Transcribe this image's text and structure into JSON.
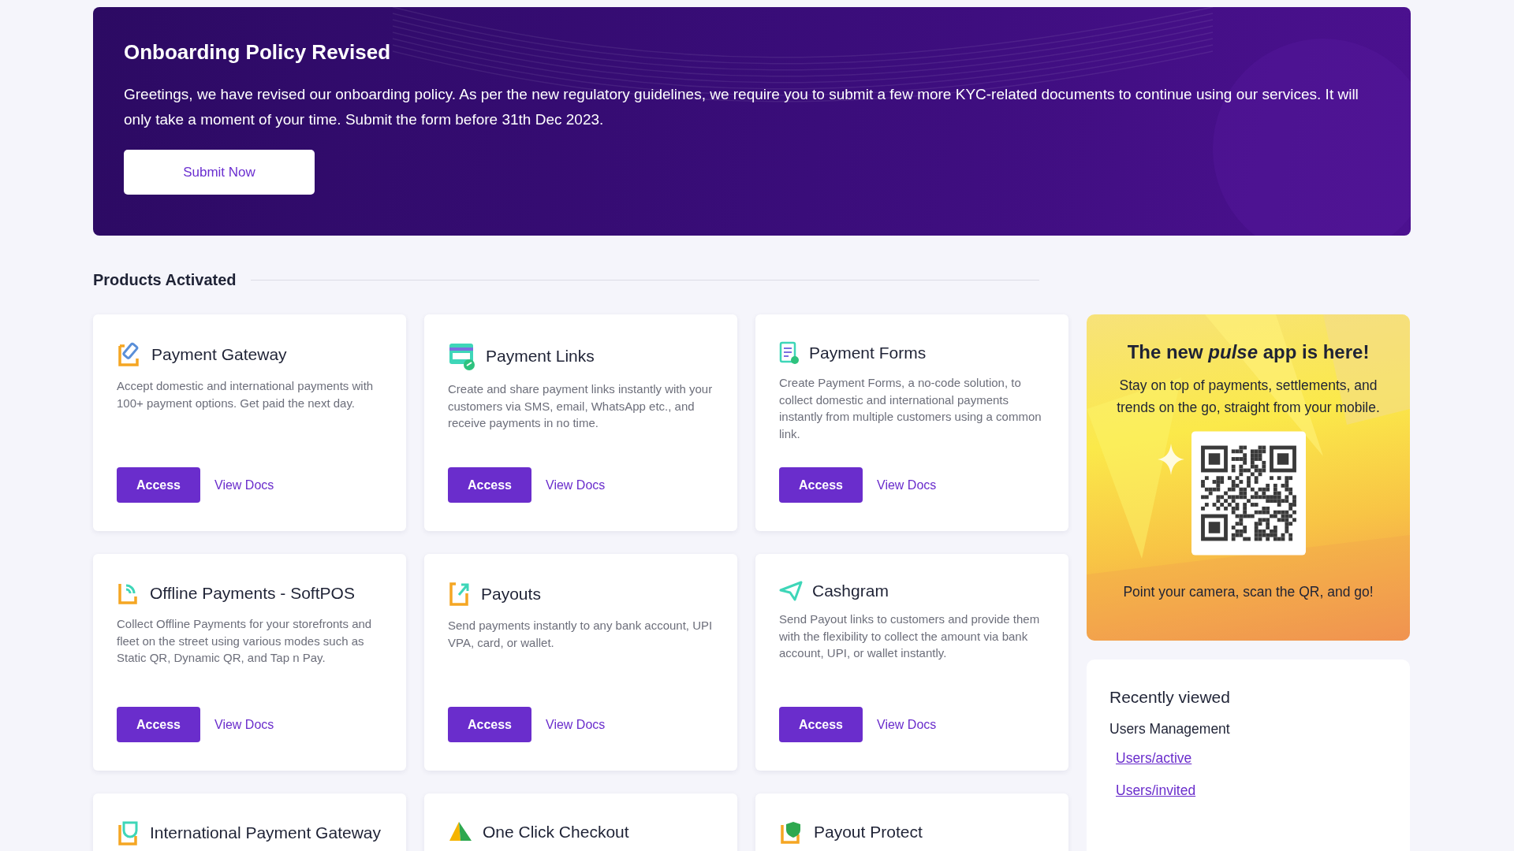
{
  "banner": {
    "title": "Onboarding Policy Revised",
    "message": "Greetings, we have revised our onboarding policy. As per the new regulatory guidelines, we require you to submit a few more KYC-related documents to continue using our services. It will only take a moment of your time. Submit the form before 31th Dec 2023.",
    "button": "Submit Now"
  },
  "section_title": "Products Activated",
  "products": [
    {
      "title": "Payment Gateway",
      "description": "Accept domestic and international payments with 100+ payment options. Get paid the next day.",
      "primary_button": "Access",
      "link": "View Docs"
    },
    {
      "title": "Payment Links",
      "description": "Create and share payment links instantly with your customers via SMS, email, WhatsApp etc., and receive payments in no time.",
      "primary_button": "Access",
      "link": "View Docs"
    },
    {
      "title": "Payment Forms",
      "description": "Create Payment Forms, a no-code solution, to collect domestic and international payments instantly from multiple customers using a common link.",
      "primary_button": "Access",
      "link": "View Docs"
    },
    {
      "title": "Offline Payments - SoftPOS",
      "description": "Collect Offline Payments for your storefronts and fleet on the street using various modes such as Static QR, Dynamic QR, and Tap n Pay.",
      "primary_button": "Access",
      "link": "View Docs"
    },
    {
      "title": "Payouts",
      "description": "Send payments instantly to any bank account, UPI VPA, card, or wallet.",
      "primary_button": "Access",
      "link": "View Docs"
    },
    {
      "title": "Cashgram",
      "description": "Send Payout links to customers and provide them with the flexibility to collect the amount via bank account, UPI, or wallet instantly.",
      "primary_button": "Access",
      "link": "View Docs"
    },
    {
      "title": "International Payment Gateway"
    },
    {
      "title": "One Click Checkout"
    },
    {
      "title": "Payout Protect"
    }
  ],
  "promo": {
    "title": "The new *pulse* app is here!",
    "subtitle": "Stay on top of payments, settlements, and trends on the go, straight from your mobile.",
    "caption": "Point your camera, scan the QR, and go!"
  },
  "recently_viewed": {
    "title": "Recently viewed",
    "group": "Users Management",
    "links": [
      "Users/active",
      "Users/invited"
    ]
  }
}
